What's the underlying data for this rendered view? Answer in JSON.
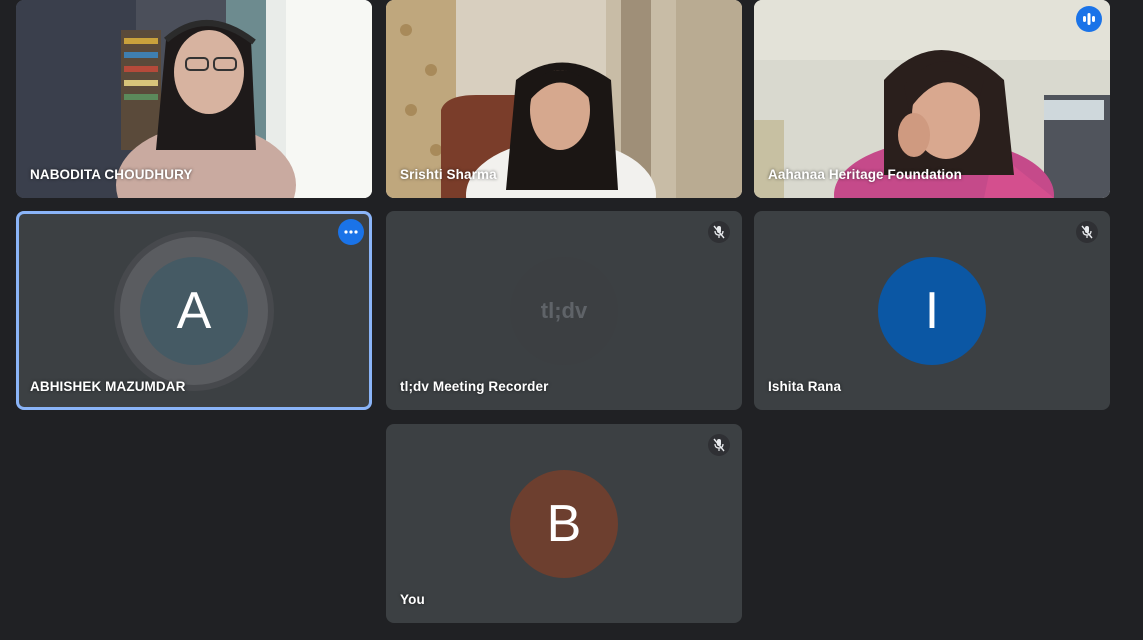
{
  "participants": [
    {
      "name": "NABODITA CHOUDHURY",
      "type": "video"
    },
    {
      "name": "Srishti Sharma",
      "type": "video"
    },
    {
      "name": "Aahanaa Heritage Foundation",
      "type": "video",
      "speaking": true
    },
    {
      "name": "ABHISHEK MAZUMDAR",
      "type": "avatar",
      "initial": "A",
      "avatar_color": "#455a64",
      "pinned": true
    },
    {
      "name": "tl;dv Meeting Recorder",
      "type": "avatar",
      "initial": "tl;dv",
      "avatar_color": "#3c3f42",
      "muted": true
    },
    {
      "name": "Ishita Rana",
      "type": "avatar",
      "initial": "I",
      "avatar_color": "#0b57a4",
      "muted": true
    },
    {
      "name": "You",
      "type": "avatar",
      "initial": "B",
      "avatar_color": "#6d3f2f",
      "muted": true
    }
  ],
  "icons": {
    "mic_off": "mic-off-icon",
    "more": "more-options-icon",
    "speaking": "audio-level-icon"
  },
  "colors": {
    "background": "#202124",
    "tile": "#3c4043",
    "accent": "#1a73e8",
    "active_border": "#8ab4f8"
  }
}
